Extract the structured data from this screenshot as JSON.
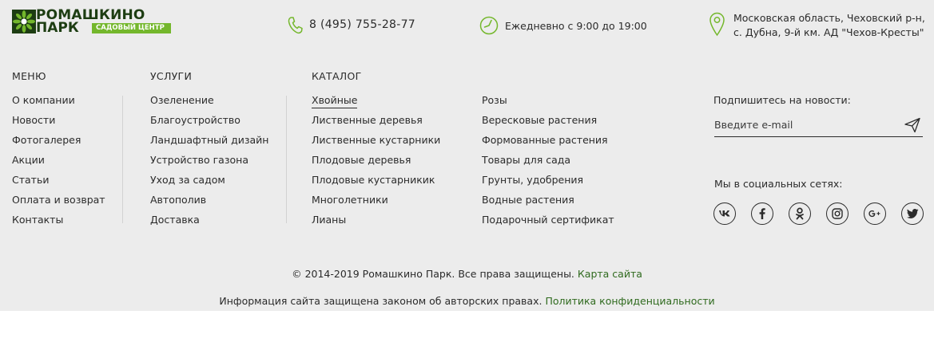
{
  "brand": {
    "name": "РОМАШКИНО",
    "park": "ПАРК",
    "badge": "САДОВЫЙ ЦЕНТР",
    "colors": {
      "green": "#74b72c",
      "dark": "#1d3d12",
      "link": "#2f6a1e"
    }
  },
  "contacts": {
    "phone_icon": "phone-icon",
    "phone": "8 (495) 755-28-77",
    "hours_icon": "clock-icon",
    "hours": "Ежедневно с 9:00 до 19:00",
    "address_icon": "location-pin-icon",
    "address_line1": "Московская область, Чеховский р-н,",
    "address_line2": "с. Дубна, 9-й км. АД \"Чехов-Кресты\""
  },
  "menu": {
    "title": "МЕНЮ",
    "items": [
      "О компании",
      "Новости",
      "Фотогалерея",
      "Акции",
      "Статьи",
      "Оплата и возврат",
      "Контакты"
    ]
  },
  "services": {
    "title": "УСЛУГИ",
    "items": [
      "Озеленение",
      "Благоустройство",
      "Ландшафтный дизайн",
      "Устройство газона",
      "Уход за садом",
      "Автополив",
      "Доставка"
    ]
  },
  "catalog": {
    "title": "КАТАЛОГ",
    "col1": [
      "Хвойные",
      "Лиственные деревья",
      "Лиственные кустарники",
      "Плодовые деревья",
      "Плодовые кустарникик",
      "Многолетники",
      "Лианы"
    ],
    "col2": [
      "Розы",
      "Вересковые растения",
      "Формованные растения",
      "Товары для сада",
      "Грунты, удобрения",
      "Водные растения",
      "Подарочный сертификат"
    ]
  },
  "subscribe": {
    "label": "Подпишитесь на новости:",
    "placeholder": "Введите e-mail",
    "send_icon": "send-icon"
  },
  "social": {
    "label": "Мы в социальных сетях:",
    "icons": [
      "vk-icon",
      "facebook-icon",
      "odnoklassniki-icon",
      "instagram-icon",
      "google-plus-icon",
      "twitter-icon"
    ]
  },
  "footer": {
    "copyright": "© 2014-2019 Ромашкино Парк. Все права защищены.",
    "sitemap": "Карта сайта",
    "legal": "Информация сайта защищена законом об авторских правах.",
    "privacy": "Политика конфиденциальности"
  }
}
